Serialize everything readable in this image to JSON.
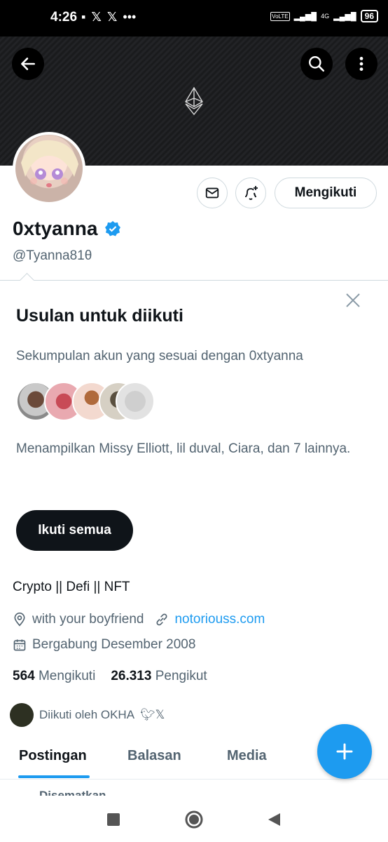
{
  "status_bar": {
    "time": "4:26",
    "right": [
      "VoLTE",
      "4G",
      "96"
    ]
  },
  "profile": {
    "name": "0xtyanna",
    "handle": "@Tyanna81θ",
    "follow_label": "Mengikuti",
    "bio": "Crypto || Defi || NFT",
    "location": "with your boyfriend",
    "website": "notoriouss.com",
    "joined": "Bergabung Desember 2008",
    "following_count": "564",
    "following_label": "Mengikuti",
    "followers_count": "26.313",
    "followers_label": "Pengikut",
    "followed_by": "Diikuti oleh OKHA"
  },
  "suggestions": {
    "title": "Usulan untuk diikuti",
    "subtitle": "Sekumpulan akun yang sesuai dengan 0xtyanna",
    "description": "Menampilkan Missy Elliott, lil duval, Ciara, dan 7 lainnya.",
    "follow_all_label": "Ikuti semua"
  },
  "tabs": [
    {
      "label": "Postingan",
      "active": true
    },
    {
      "label": "Balasan",
      "active": false
    },
    {
      "label": "Media",
      "active": false
    }
  ],
  "pinned_label": "Disematkan",
  "colors": {
    "accent": "#1d9bf0",
    "text": "#0f1419",
    "secondary": "#536471"
  },
  "icons": [
    "back-arrow-icon",
    "search-icon",
    "more-vertical-icon",
    "ethereum-logo-icon",
    "mail-icon",
    "bell-plus-icon",
    "verified-badge-icon",
    "close-icon",
    "location-icon",
    "link-icon",
    "calendar-icon",
    "plus-icon"
  ]
}
